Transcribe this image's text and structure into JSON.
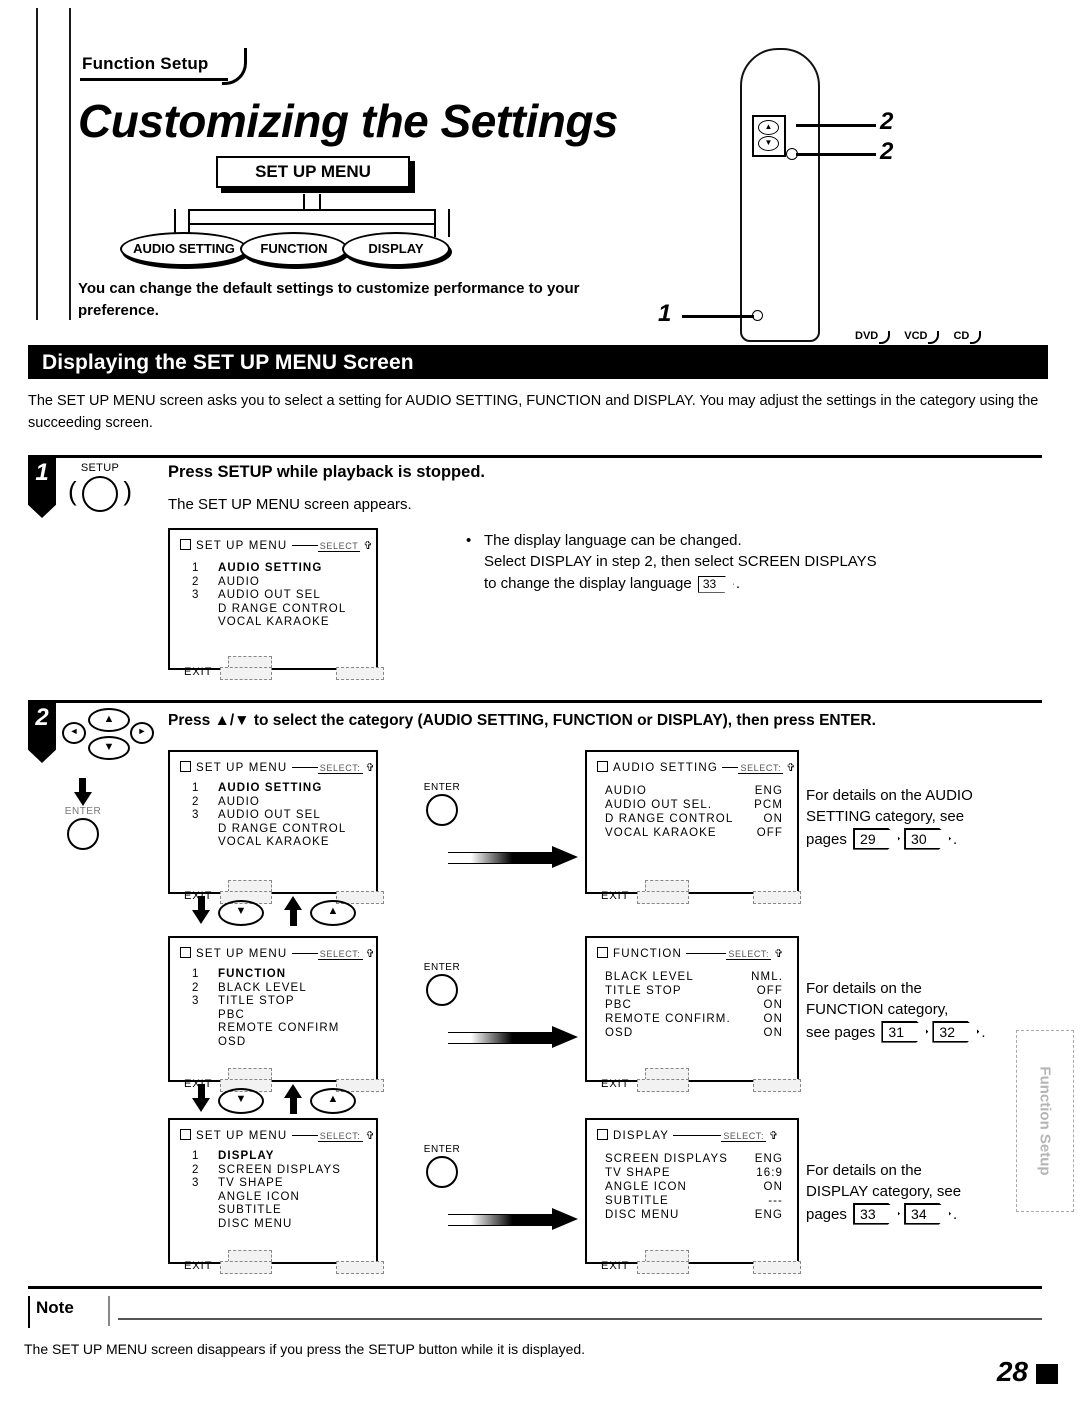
{
  "page": {
    "number": "28",
    "side_tab": "Function Setup"
  },
  "header": {
    "eyebrow": "Function Setup",
    "title": "Customizing the Settings",
    "intro": "You can change the default settings to customize performance to your preference."
  },
  "diagram": {
    "root": "SET UP MENU",
    "branches": [
      "AUDIO SETTING",
      "FUNCTION",
      "DISPLAY"
    ]
  },
  "remote": {
    "callouts": [
      "2",
      "2",
      "1"
    ],
    "disc_badges": [
      "DVD",
      "VCD",
      "CD"
    ]
  },
  "section": {
    "heading": "Displaying the SET UP MENU Screen",
    "intro": "The SET UP MENU screen asks you to select a setting for AUDIO SETTING, FUNCTION and DISPLAY.  You may adjust the settings in the category using the succeeding screen."
  },
  "step1": {
    "number": "1",
    "key_label": "SETUP",
    "heading": "Press SETUP while playback is stopped.",
    "sub": "The SET UP MENU screen appears.",
    "bullet": {
      "line1": "The display language can be changed.",
      "line2": "Select DISPLAY in step 2, then select SCREEN DISPLAYS",
      "line3_pre": "to change the display language",
      "line3_page": "33",
      "line3_post": "."
    },
    "screen": {
      "title": "SET UP MENU",
      "select_label": "SELECT",
      "rows": [
        {
          "num": "1",
          "label": "AUDIO SETTING",
          "bold": true
        },
        {
          "num": "2",
          "label": "AUDIO",
          "bold": false
        },
        {
          "num": "3",
          "label": "AUDIO OUT SEL",
          "bold": false
        },
        {
          "num": "",
          "label": "D RANGE CONTROL",
          "bold": false
        },
        {
          "num": "",
          "label": "VOCAL KARAOKE",
          "bold": false
        }
      ],
      "exit": "EXIT"
    }
  },
  "step2": {
    "number": "2",
    "enter_key_label": "ENTER",
    "heading": "Press ▲/▼ to select the category (AUDIO SETTING, FUNCTION or DISPLAY), then press ENTER.",
    "rows": [
      {
        "left_screen": {
          "title": "SET UP MENU",
          "select_label": "SELECT:",
          "rows": [
            {
              "num": "1",
              "label": "AUDIO SETTING",
              "bold": true
            },
            {
              "num": "2",
              "label": "AUDIO",
              "bold": false
            },
            {
              "num": "3",
              "label": "AUDIO OUT SEL",
              "bold": false
            },
            {
              "num": "",
              "label": "D RANGE CONTROL",
              "bold": false
            },
            {
              "num": "",
              "label": "VOCAL KARAOKE",
              "bold": false
            }
          ],
          "exit": "EXIT"
        },
        "right_screen": {
          "title": "AUDIO SETTING",
          "select_label": "SELECT:",
          "items": [
            {
              "key": "AUDIO",
              "value": "ENG"
            },
            {
              "key": "AUDIO OUT SEL.",
              "value": "PCM"
            },
            {
              "key": "D RANGE CONTROL",
              "value": "ON"
            },
            {
              "key": "VOCAL KARAOKE",
              "value": "OFF"
            }
          ],
          "exit": "EXIT"
        },
        "detail": {
          "line1": "For details on the AUDIO",
          "line2": "SETTING category, see",
          "line3": "pages",
          "pages": [
            "29",
            "30"
          ],
          "suffix": "."
        }
      },
      {
        "left_screen": {
          "title": "SET UP MENU",
          "select_label": "SELECT:",
          "rows": [
            {
              "num": "1",
              "label": "FUNCTION",
              "bold": true
            },
            {
              "num": "2",
              "label": "BLACK LEVEL",
              "bold": false
            },
            {
              "num": "3",
              "label": "TITLE STOP",
              "bold": false
            },
            {
              "num": "",
              "label": "PBC",
              "bold": false
            },
            {
              "num": "",
              "label": "REMOTE CONFIRM",
              "bold": false
            },
            {
              "num": "",
              "label": "OSD",
              "bold": false
            }
          ],
          "exit": "EXIT"
        },
        "right_screen": {
          "title": "FUNCTION",
          "select_label": "SELECT:",
          "items": [
            {
              "key": "BLACK LEVEL",
              "value": "NML."
            },
            {
              "key": "TITLE STOP",
              "value": "OFF"
            },
            {
              "key": "PBC",
              "value": "ON"
            },
            {
              "key": "REMOTE CONFIRM.",
              "value": "ON"
            },
            {
              "key": "OSD",
              "value": "ON"
            }
          ],
          "exit": "EXIT"
        },
        "detail": {
          "line1": "For details on the",
          "line2": "FUNCTION category,",
          "line3": "see pages",
          "pages": [
            "31",
            "32"
          ],
          "suffix": "."
        }
      },
      {
        "left_screen": {
          "title": "SET UP MENU",
          "select_label": "SELECT:",
          "rows": [
            {
              "num": "1",
              "label": "DISPLAY",
              "bold": true
            },
            {
              "num": "2",
              "label": "SCREEN DISPLAYS",
              "bold": false
            },
            {
              "num": "3",
              "label": "TV SHAPE",
              "bold": false
            },
            {
              "num": "",
              "label": "ANGLE ICON",
              "bold": false
            },
            {
              "num": "",
              "label": "SUBTITLE",
              "bold": false
            },
            {
              "num": "",
              "label": "DISC MENU",
              "bold": false
            }
          ],
          "exit": "EXIT"
        },
        "right_screen": {
          "title": "DISPLAY",
          "select_label": "SELECT:",
          "items": [
            {
              "key": "SCREEN DISPLAYS",
              "value": "ENG"
            },
            {
              "key": "TV SHAPE",
              "value": "16:9"
            },
            {
              "key": "ANGLE ICON",
              "value": "ON"
            },
            {
              "key": "SUBTITLE",
              "value": "---"
            },
            {
              "key": "DISC MENU",
              "value": "ENG"
            }
          ],
          "exit": "EXIT"
        },
        "detail": {
          "line1": "For details on the",
          "line2": "DISPLAY category, see",
          "line3": "pages",
          "pages": [
            "33",
            "34"
          ],
          "suffix": "."
        }
      }
    ],
    "nav": {
      "down_label": "▼",
      "up_label": "▲",
      "left_label": "◄",
      "right_label": "►"
    }
  },
  "note": {
    "label": "Note",
    "text": "The SET UP MENU screen disappears if you press the SETUP button while it is displayed."
  }
}
